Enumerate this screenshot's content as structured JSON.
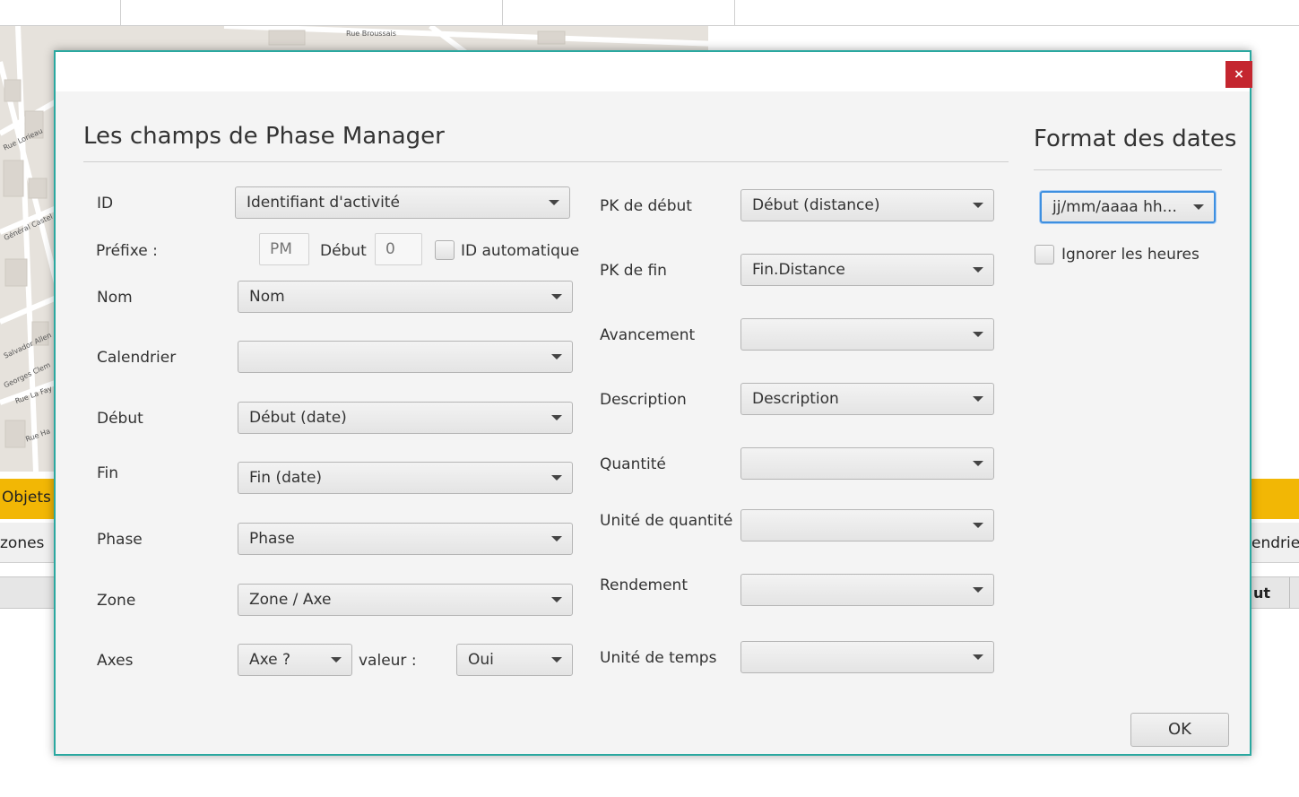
{
  "background": {
    "streets": [
      "Rue Broussais",
      "Rue Lorieau",
      "Général Castel",
      "Salvador Allen",
      "Georges Clem",
      "Rue La Fay",
      "Rue Ha"
    ],
    "objets_label": "Objets",
    "tab_left": "zones",
    "tab_right": "endrier",
    "header_right": "ut"
  },
  "dialog": {
    "close_label": "×",
    "left_title": "Les champs de Phase Manager",
    "right_title": "Format des dates",
    "ok_label": "OK",
    "left_fields": {
      "id_label": "ID",
      "id_value": "Identifiant d'activité",
      "prefixe_label": "Préfixe :",
      "prefixe_placeholder": "PM",
      "debut_inline_label": "Début",
      "debut_placeholder": "0",
      "id_auto_label": "ID automatique",
      "nom_label": "Nom",
      "nom_value": "Nom",
      "calendrier_label": "Calendrier",
      "calendrier_value": "",
      "debut_label": "Début",
      "debut_value": "Début (date)",
      "fin_label": "Fin",
      "fin_value": "Fin (date)",
      "phase_label": "Phase",
      "phase_value": "Phase",
      "zone_label": "Zone",
      "zone_value": "Zone / Axe",
      "axes_label": "Axes",
      "axes_value": "Axe ?",
      "valeur_label": "valeur :",
      "valeur_value": "Oui"
    },
    "middle_fields": {
      "pk_debut_label": "PK de début",
      "pk_debut_value": "Début (distance)",
      "pk_fin_label": "PK de fin",
      "pk_fin_value": "Fin.Distance",
      "avancement_label": "Avancement",
      "avancement_value": "",
      "description_label": "Description",
      "description_value": "Description",
      "quantite_label": "Quantité",
      "quantite_value": "",
      "unite_quantite_label": "Unité de quantité",
      "unite_quantite_value": "",
      "rendement_label": "Rendement",
      "rendement_value": "",
      "unite_temps_label": "Unité de temps",
      "unite_temps_value": ""
    },
    "date_format": {
      "value": "jj/mm/aaaa hh...",
      "ignore_hours_label": "Ignorer les heures"
    }
  },
  "colors": {
    "dialog_border": "#2aa8a0",
    "close_button": "#c4262f",
    "objets_bar": "#f2b705",
    "focus": "#3d8fe0"
  }
}
